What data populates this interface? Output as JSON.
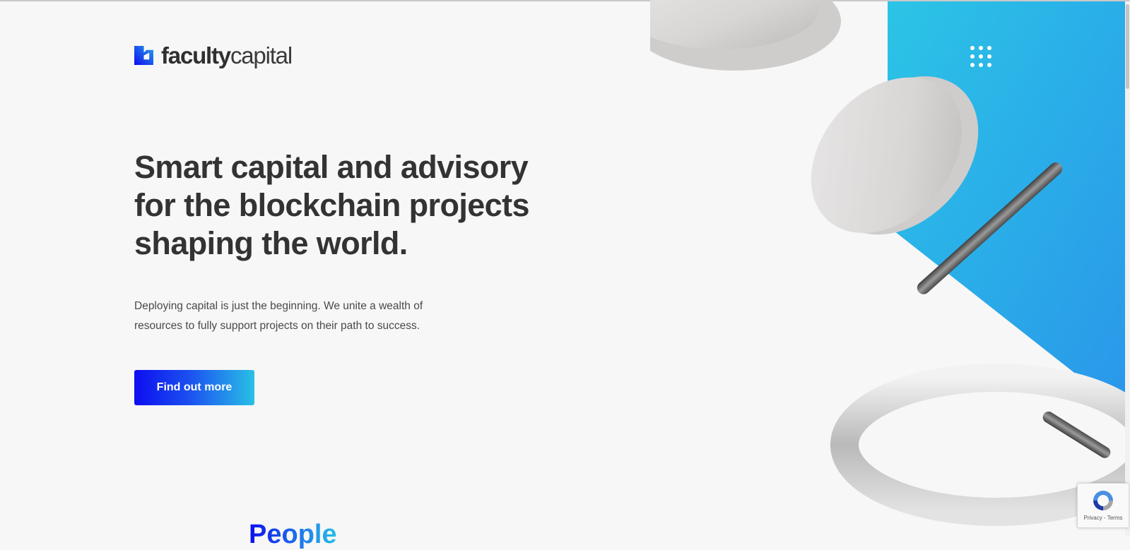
{
  "brand": {
    "name_bold": "faculty",
    "name_light": "capital",
    "logo_icon": "faculty-capital-logo-mark",
    "colors": {
      "blue": "#0d0ef0",
      "cyan": "#29c0e6",
      "sky": "#2aa0ea"
    }
  },
  "hero": {
    "headline": "Smart capital and advisory for the blockchain projects shaping the world.",
    "intro": "Deploying capital is just the beginning. We unite a wealth of resources to fully support projects on their path to success.",
    "cta_label": "Find out more"
  },
  "menu": {
    "icon": "grid-menu-icon"
  },
  "next_section": {
    "heading_peek": "People"
  },
  "recaptcha": {
    "icon": "recaptcha-icon",
    "privacy": "Privacy",
    "separator": " - ",
    "terms": "Terms"
  }
}
